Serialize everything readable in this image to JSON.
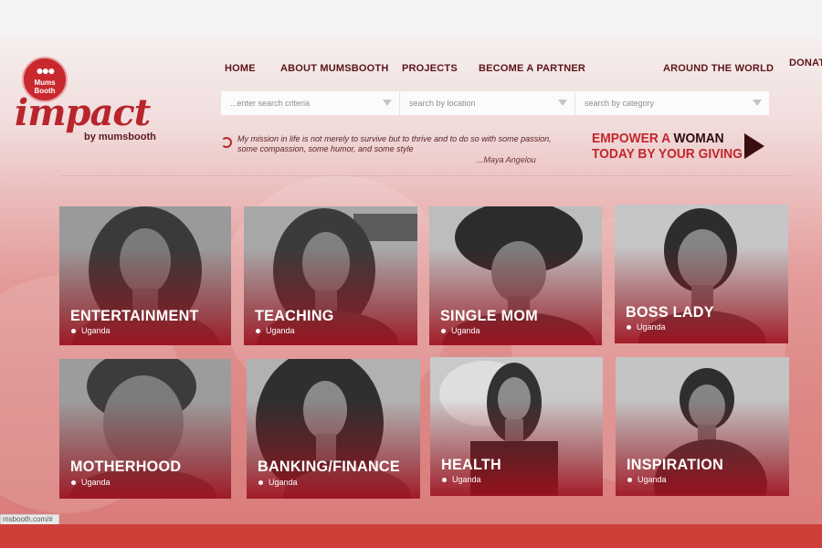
{
  "logo": {
    "badge_text": "Mums Booth",
    "wordmark": "impact",
    "sub": "by mumsbooth"
  },
  "nav": {
    "home": "HOME",
    "about": "ABOUT MUMSBOOTH",
    "projects": "PROJECTS",
    "partner": "BECOME A PARTNER",
    "around": "AROUND THE WORLD",
    "donate": "DONATE"
  },
  "search": {
    "criteria_placeholder": "...enter search criteria",
    "location_placeholder": "search by location",
    "category_placeholder": "search by category"
  },
  "quote": {
    "text": "My mission in life is not merely to survive but to thrive and to do so with some passion, some compassion, some humor, and some style",
    "author": "...Maya Angelou"
  },
  "cta": {
    "line1_a": "EMPOWER A ",
    "line1_b": "WOMAN",
    "line2": "TODAY BY YOUR GIVING"
  },
  "cards": [
    {
      "title": "ENTERTAINMENT",
      "location": "Uganda"
    },
    {
      "title": "TEACHING",
      "location": "Uganda"
    },
    {
      "title": "SINGLE MOM",
      "location": "Uganda"
    },
    {
      "title": "BOSS LADY",
      "location": "Uganda"
    },
    {
      "title": "MOTHERHOOD",
      "location": "Uganda"
    },
    {
      "title": "BANKING/FINANCE",
      "location": "Uganda"
    },
    {
      "title": "HEALTH",
      "location": "Uganda"
    },
    {
      "title": "INSPIRATION",
      "location": "Uganda"
    }
  ],
  "status_url": "msbooth.com/#",
  "colors": {
    "brand_red": "#c1272d",
    "nav_text": "#5b1518",
    "bottom_bar": "#cf3f3a"
  }
}
